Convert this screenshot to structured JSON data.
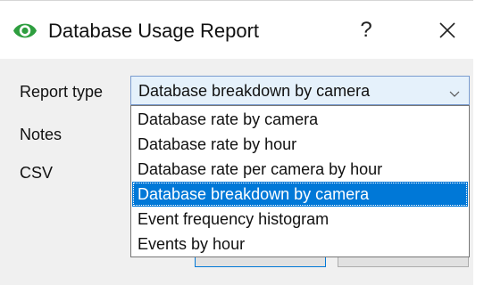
{
  "window": {
    "title": "Database Usage Report",
    "help_label": "?",
    "icon": "eye-logo-icon",
    "close_icon": "close-icon"
  },
  "form": {
    "report_type_label": "Report type",
    "notes_label": "Notes",
    "csv_label": "CSV",
    "report_type_value": "Database breakdown by camera"
  },
  "dropdown": {
    "options": [
      "Database rate by camera",
      "Database rate by hour",
      "Database rate per camera by hour",
      "Database breakdown by camera",
      "Event frequency histogram",
      "Events by hour"
    ],
    "selected_index": 3
  },
  "colors": {
    "accent": "#0078d7",
    "logo_green": "#2e9e3f",
    "client_bg": "#f0f0f0"
  }
}
